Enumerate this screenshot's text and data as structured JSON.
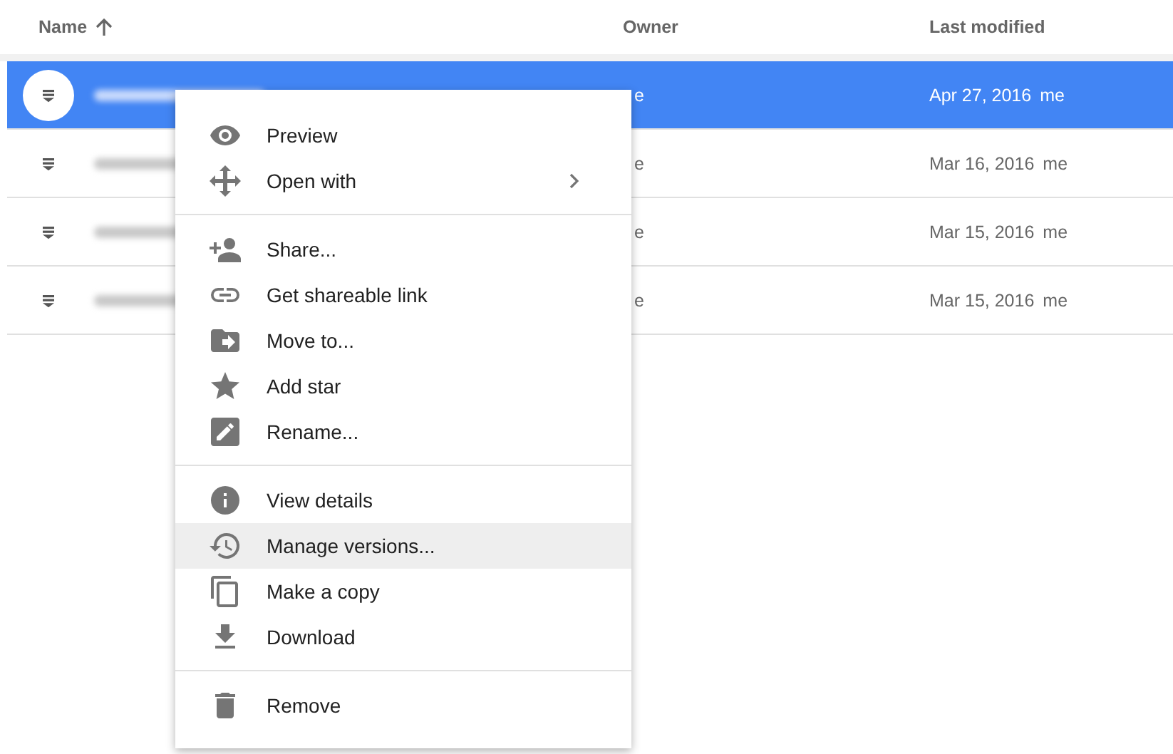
{
  "table": {
    "columns": [
      {
        "label": "Name",
        "sorted": true
      },
      {
        "label": "Owner",
        "sorted": false
      },
      {
        "label": "Last modified",
        "sorted": false
      }
    ],
    "rows": [
      {
        "selected": true,
        "owner": "e",
        "modified": "Apr 27, 2016",
        "modified_by": "me"
      },
      {
        "selected": false,
        "owner": "e",
        "modified": "Mar 16, 2016",
        "modified_by": "me"
      },
      {
        "selected": false,
        "owner": "e",
        "modified": "Mar 15, 2016",
        "modified_by": "me"
      },
      {
        "selected": false,
        "owner": "e",
        "modified": "Mar 15, 2016",
        "modified_by": "me"
      }
    ]
  },
  "context_menu": {
    "sections": [
      {
        "items": [
          {
            "label": "Preview",
            "hovered": false,
            "has_submenu": false
          },
          {
            "label": "Open with",
            "hovered": false,
            "has_submenu": true
          }
        ]
      },
      {
        "items": [
          {
            "label": "Share...",
            "hovered": false,
            "has_submenu": false
          },
          {
            "label": "Get shareable link",
            "hovered": false,
            "has_submenu": false
          },
          {
            "label": "Move to...",
            "hovered": false,
            "has_submenu": false
          },
          {
            "label": "Add star",
            "hovered": false,
            "has_submenu": false
          },
          {
            "label": "Rename...",
            "hovered": false,
            "has_submenu": false
          }
        ]
      },
      {
        "items": [
          {
            "label": "View details",
            "hovered": false,
            "has_submenu": false
          },
          {
            "label": "Manage versions...",
            "hovered": true,
            "has_submenu": false
          },
          {
            "label": "Make a copy",
            "hovered": false,
            "has_submenu": false
          },
          {
            "label": "Download",
            "hovered": false,
            "has_submenu": false
          }
        ]
      },
      {
        "items": [
          {
            "label": "Remove",
            "hovered": false,
            "has_submenu": false
          }
        ]
      }
    ]
  }
}
